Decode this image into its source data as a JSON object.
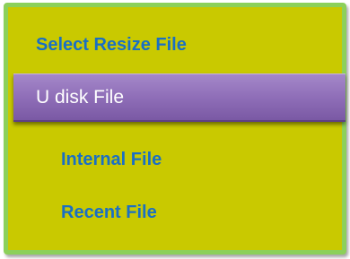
{
  "menu": {
    "title": "Select Resize File",
    "items": [
      {
        "label": "U disk File",
        "selected": true
      },
      {
        "label": "Internal File",
        "selected": false
      },
      {
        "label": "Recent File",
        "selected": false
      }
    ]
  },
  "colors": {
    "panel_background": "#c9c900",
    "panel_border": "#8cd05a",
    "title_text": "#1a6fc4",
    "item_text": "#1a6fc4",
    "selected_background": "#8d6cb6",
    "selected_text": "#ffffff"
  }
}
